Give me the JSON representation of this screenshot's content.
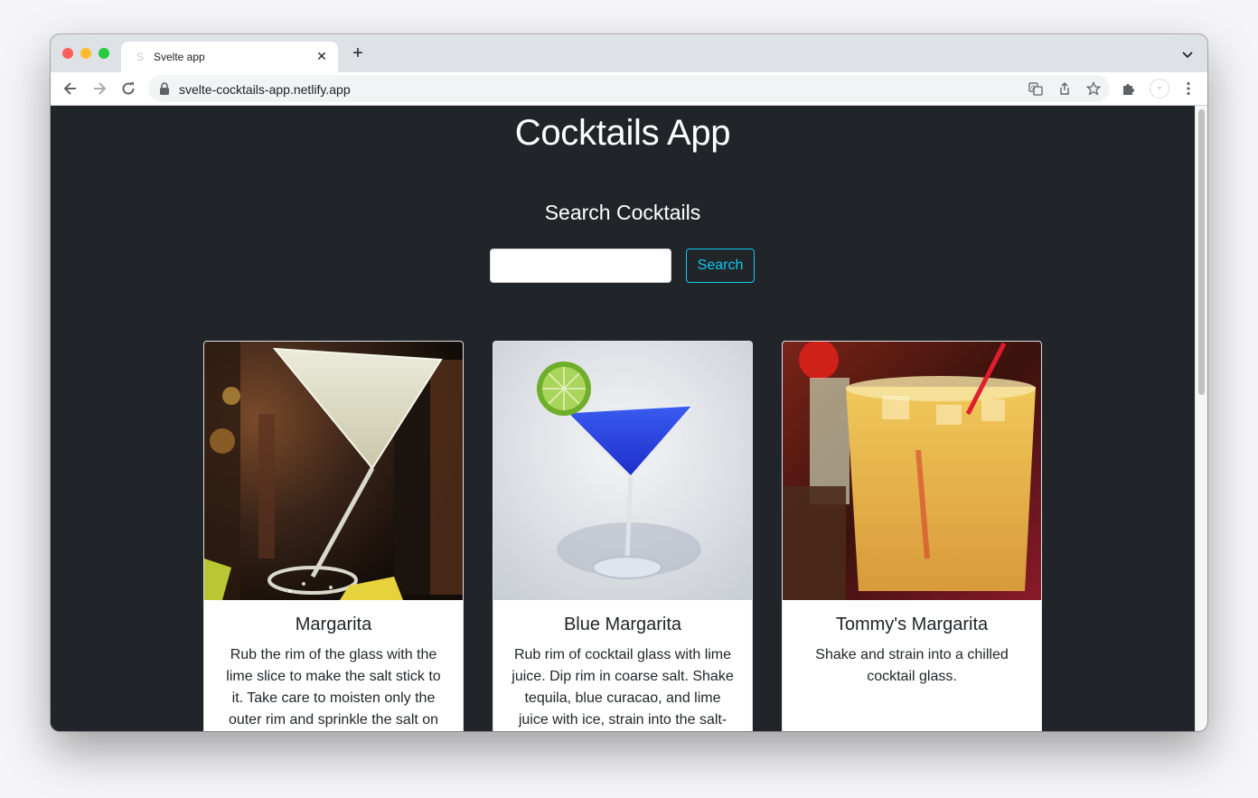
{
  "browser": {
    "tab_title": "Svelte app",
    "url": "svelte-cocktails-app.netlify.app",
    "profile_badge": "▿"
  },
  "page": {
    "title": "Cocktails App",
    "search_heading": "Search Cocktails",
    "search_input_value": "",
    "search_button_label": "Search"
  },
  "cards": [
    {
      "title": "Margarita",
      "instructions": "Rub the rim of the glass with the lime slice to make the salt stick to it. Take care to moisten only the outer rim and sprinkle the salt on",
      "image_subject": "margarita-glass"
    },
    {
      "title": "Blue Margarita",
      "instructions": "Rub rim of cocktail glass with lime juice. Dip rim in coarse salt. Shake tequila, blue curacao, and lime juice with ice, strain into the salt-",
      "image_subject": "blue-margarita-glass"
    },
    {
      "title": "Tommy's Margarita",
      "instructions": "Shake and strain into a chilled cocktail glass.",
      "image_subject": "tommys-margarita-glass"
    }
  ],
  "colors": {
    "page_bg": "#212529",
    "accent": "#0dcaf0",
    "card_bg": "#ffffff"
  }
}
